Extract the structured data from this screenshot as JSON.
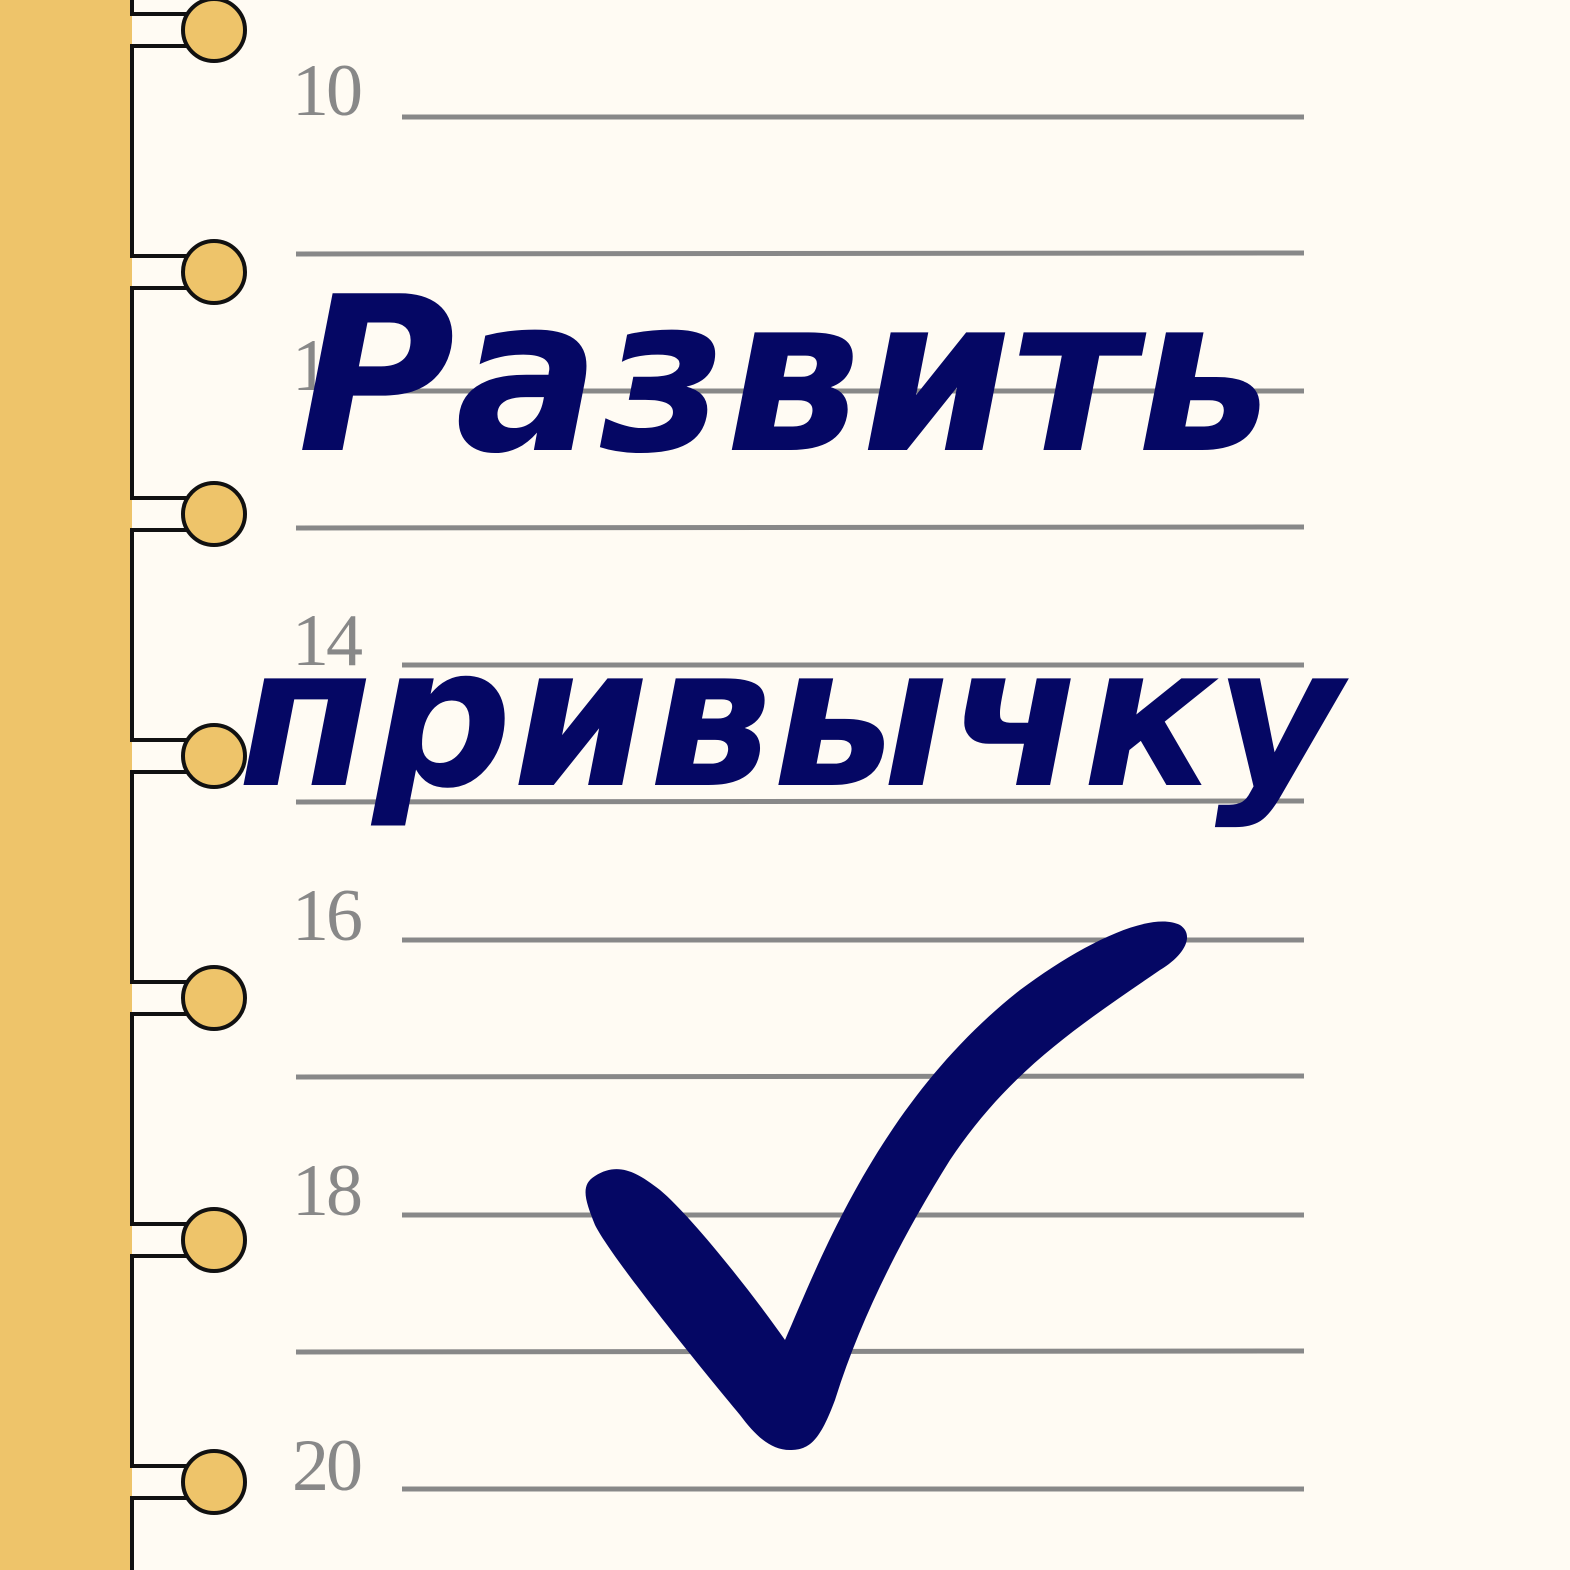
{
  "colors": {
    "paper": "#fffbf3",
    "binding": "#eec46a",
    "ring": "#eec46a",
    "rule_line": "#888888",
    "hour_text": "#888888",
    "ink": "#050764"
  },
  "hours": [
    "10",
    "12",
    "14",
    "16",
    "18",
    "20"
  ],
  "title": {
    "line1": "Развить",
    "line2": "привычку"
  },
  "icons": {
    "check": "checkmark-icon",
    "ring": "binder-ring-icon"
  }
}
